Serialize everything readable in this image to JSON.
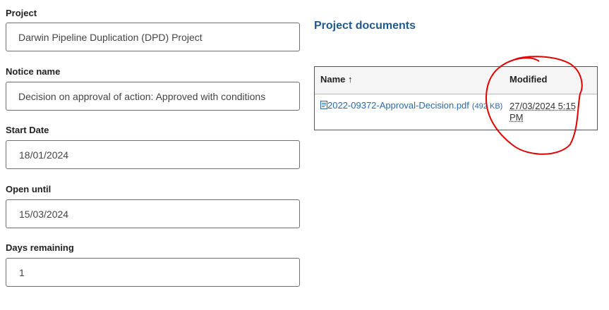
{
  "fields": [
    {
      "label": "Project",
      "value": "Darwin Pipeline Duplication (DPD) Project"
    },
    {
      "label": "Notice name",
      "value": "Decision on approval of action: Approved with conditions"
    },
    {
      "label": "Start Date",
      "value": "18/01/2024"
    },
    {
      "label": "Open until",
      "value": "15/03/2024"
    },
    {
      "label": "Days remaining",
      "value": "1"
    }
  ],
  "documents": {
    "title": "Project documents",
    "columns": {
      "name": "Name ↑",
      "modified": "Modified"
    },
    "rows": [
      {
        "file": "2022-09372-Approval-Decision.pdf",
        "size": "(492 KB)",
        "modified": "27/03/2024 5:15 PM"
      }
    ]
  },
  "annotation": {
    "color": "#e00000"
  }
}
